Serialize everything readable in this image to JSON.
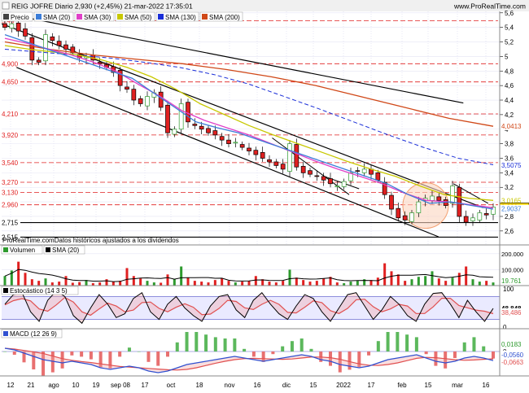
{
  "header": {
    "title": "REIG JOFRE Diario 2,930 (+2,45%) 21-mar-2022 17:35:01",
    "site": "www.ProRealTime.com"
  },
  "footer_note": "ProRealTime.comDatos históricos ajustados a los dividendos",
  "colors": {
    "up": "#2e9a2e",
    "down": "#e02020",
    "sma20": "#3b7dd8",
    "sma30": "#e040c8",
    "sma50": "#c8c800",
    "sma130": "#1a2ed8",
    "sma200": "#d04818",
    "support_line": "#e02020",
    "grid": "#b8b8e8",
    "circle": "#f4a070"
  },
  "chart_data": [
    {
      "type": "line",
      "panel": "price",
      "legend": [
        "Precio",
        "SMA (20)",
        "SMA (30)",
        "SMA (50)",
        "SMA (130)",
        "SMA (200)"
      ],
      "x_ticks": [
        "12",
        "21",
        "ago",
        "10",
        "19",
        "sep 08",
        "17",
        "oct",
        "18",
        "nov",
        "16",
        "dic",
        "15",
        "2022",
        "17",
        "feb",
        "15",
        "mar",
        "16"
      ],
      "y_ticks": [
        "5,6",
        "5,4",
        "5,2",
        "5",
        "4,8",
        "4,6",
        "4,4",
        "4,2",
        "4",
        "3,8",
        "3,6",
        "3,4",
        "3,2",
        "3",
        "2,8",
        "2,6"
      ],
      "ylim": [
        2.52,
        5.62
      ],
      "horizontal_levels": [
        "5,49",
        "4,900",
        "4,650",
        "4,210",
        "3,920",
        "3,540",
        "3,270",
        "3,130",
        "2,960",
        "2,715",
        "2,515"
      ],
      "right_labels": [
        {
          "text": "4,0413",
          "value": 4.0413,
          "color": "#d04818"
        },
        {
          "text": "3,5075",
          "value": 3.5075,
          "color": "#1a2ed8"
        },
        {
          "text": "3,0165",
          "value": 3.0165,
          "color": "#c8c800"
        },
        {
          "text": "2,930",
          "value": 2.93,
          "color": "#000000"
        },
        {
          "text": "2,9037",
          "value": 2.9037,
          "color": "#3b7dd8"
        }
      ],
      "price_approx": [
        5.4,
        5.45,
        5.35,
        5.28,
        4.95,
        4.92,
        5.3,
        5.22,
        5.15,
        5.1,
        5.05,
        4.98,
        5.0,
        4.95,
        4.9,
        4.85,
        4.78,
        4.6,
        4.55,
        4.4,
        4.35,
        4.45,
        4.5,
        4.3,
        3.95,
        4.0,
        4.35,
        4.1,
        4.05,
        4.0,
        3.95,
        3.92,
        3.85,
        3.8,
        3.82,
        3.75,
        3.7,
        3.65,
        3.6,
        3.55,
        3.5,
        3.45,
        3.8,
        3.48,
        3.4,
        3.38,
        3.35,
        3.3,
        3.25,
        3.22,
        3.28,
        3.4,
        3.42,
        3.45,
        3.38,
        3.3,
        3.1,
        2.9,
        2.78,
        2.75,
        2.85,
        3.0,
        3.05,
        3.08,
        3.02,
        2.95,
        3.22,
        2.8,
        2.72,
        2.78,
        2.85,
        2.82,
        2.93
      ],
      "sma20_approx": [
        5.3,
        5.2,
        5.1,
        5.0,
        4.9,
        4.8,
        4.7,
        4.5,
        4.3,
        4.1,
        4.02,
        3.95,
        3.85,
        3.75,
        3.65,
        3.55,
        3.45,
        3.35,
        3.25,
        3.1,
        2.98,
        3.0,
        2.95,
        2.9
      ],
      "sma30_approx": [
        5.25,
        5.18,
        5.1,
        5.02,
        4.92,
        4.8,
        4.62,
        4.45,
        4.25,
        4.12,
        4.02,
        3.92,
        3.8,
        3.68,
        3.56,
        3.45,
        3.35,
        3.25,
        3.12,
        3.02,
        3.0,
        2.96,
        2.92
      ],
      "sma50_approx": [
        5.15,
        5.1,
        5.06,
        5.02,
        4.95,
        4.85,
        4.72,
        4.55,
        4.35,
        4.2,
        4.05,
        3.92,
        3.8,
        3.68,
        3.56,
        3.45,
        3.35,
        3.22,
        3.1,
        3.05,
        3.02
      ],
      "sma130_approx": [
        5.1,
        5.06,
        5.02,
        4.98,
        4.92,
        4.85,
        4.75,
        4.62,
        4.45,
        4.28,
        4.1,
        3.92,
        3.75,
        3.6,
        3.51
      ],
      "sma200_approx": [
        5.2,
        5.1,
        5.02,
        4.96,
        4.9,
        4.82,
        4.72,
        4.6,
        4.45,
        4.3,
        4.15,
        4.04
      ],
      "annotation": "2,930"
    },
    {
      "type": "bar",
      "panel": "volume",
      "legend": [
        "Volumen",
        "SMA (20)"
      ],
      "y_ticks": [
        "200.000",
        "100.000"
      ],
      "ylim": [
        0,
        240000
      ],
      "last_value_label": "19.761",
      "values": [
        60000,
        95000,
        150000,
        80000,
        40000,
        30000,
        45000,
        20000,
        25000,
        60000,
        18000,
        22000,
        35000,
        15000,
        20000,
        40000,
        25000,
        30000,
        110000,
        60000,
        45000,
        30000,
        20000,
        18000,
        70000,
        40000,
        120000,
        50000,
        30000,
        25000,
        20000,
        35000,
        45000,
        30000,
        20000,
        25000,
        30000,
        60000,
        40000,
        25000,
        20000,
        30000,
        100000,
        50000,
        35000,
        25000,
        30000,
        45000,
        55000,
        20000,
        15000,
        25000,
        30000,
        40000,
        35000,
        50000,
        140000,
        90000,
        70000,
        30000,
        40000,
        55000,
        60000,
        90000,
        45000,
        30000,
        50000,
        80000,
        120000,
        40000,
        25000,
        30000,
        19761
      ]
    },
    {
      "type": "line",
      "panel": "stochastic",
      "legend": [
        "Estocástico (14 3 5)"
      ],
      "y_ticks": [
        "100",
        "0"
      ],
      "ylim": [
        0,
        100
      ],
      "right_labels": [
        {
          "text": "48,848",
          "value": 48.848
        },
        {
          "text": "38,486",
          "value": 38.486
        }
      ]
    },
    {
      "type": "line",
      "panel": "macd",
      "legend": [
        "MACD (12 26 9)"
      ],
      "y_ticks": [
        "0"
      ],
      "right_labels": [
        {
          "text": "0,0183",
          "value": 0.0183
        },
        {
          "text": "-0,0560",
          "value": -0.056
        },
        {
          "text": "-0,0663",
          "value": -0.0663
        }
      ]
    }
  ]
}
